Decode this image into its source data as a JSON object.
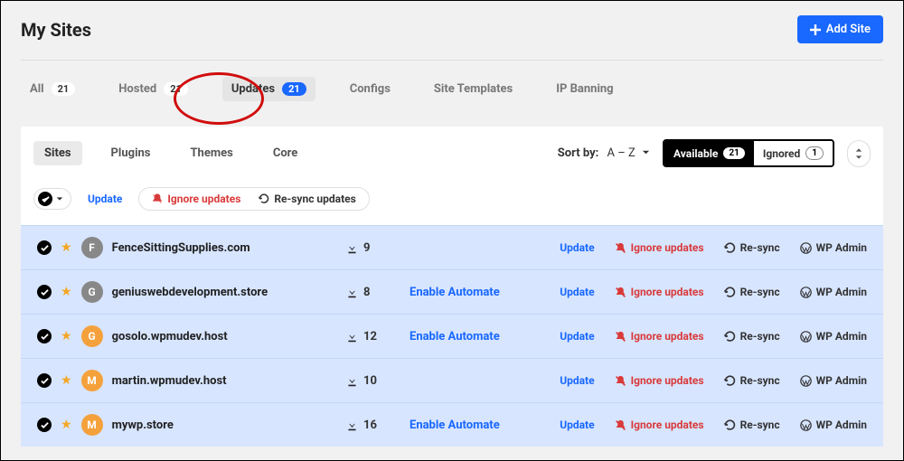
{
  "header": {
    "title": "My Sites",
    "add_label": "Add Site"
  },
  "tabs": {
    "all": {
      "label": "All",
      "count": "21"
    },
    "hosted": {
      "label": "Hosted",
      "count": "21"
    },
    "updates": {
      "label": "Updates",
      "count": "21"
    },
    "configs": {
      "label": "Configs"
    },
    "templates": {
      "label": "Site Templates"
    },
    "ipban": {
      "label": "IP Banning"
    }
  },
  "subtabs": {
    "sites": "Sites",
    "plugins": "Plugins",
    "themes": "Themes",
    "core": "Core"
  },
  "sort": {
    "label": "Sort by:",
    "value": "A – Z"
  },
  "toggle": {
    "available": {
      "label": "Available",
      "count": "21"
    },
    "ignored": {
      "label": "Ignored",
      "count": "1"
    }
  },
  "bulk": {
    "update": "Update",
    "ignore": "Ignore updates",
    "resync": "Re-sync updates"
  },
  "row_actions": {
    "update": "Update",
    "ignore": "Ignore updates",
    "resync": "Re-sync",
    "wpadmin": "WP Admin",
    "enable": "Enable Automate"
  },
  "sites": [
    {
      "letter": "F",
      "avatar": "gray",
      "name": "FenceSittingSupplies.com",
      "count": "9",
      "enable": false
    },
    {
      "letter": "G",
      "avatar": "gray",
      "name": "geniuswebdevelopment.store",
      "count": "8",
      "enable": true
    },
    {
      "letter": "G",
      "avatar": "orange",
      "name": "gosolo.wpmudev.host",
      "count": "12",
      "enable": true
    },
    {
      "letter": "M",
      "avatar": "orange",
      "name": "martin.wpmudev.host",
      "count": "10",
      "enable": false
    },
    {
      "letter": "M",
      "avatar": "orange",
      "name": "mywp.store",
      "count": "16",
      "enable": true
    }
  ]
}
